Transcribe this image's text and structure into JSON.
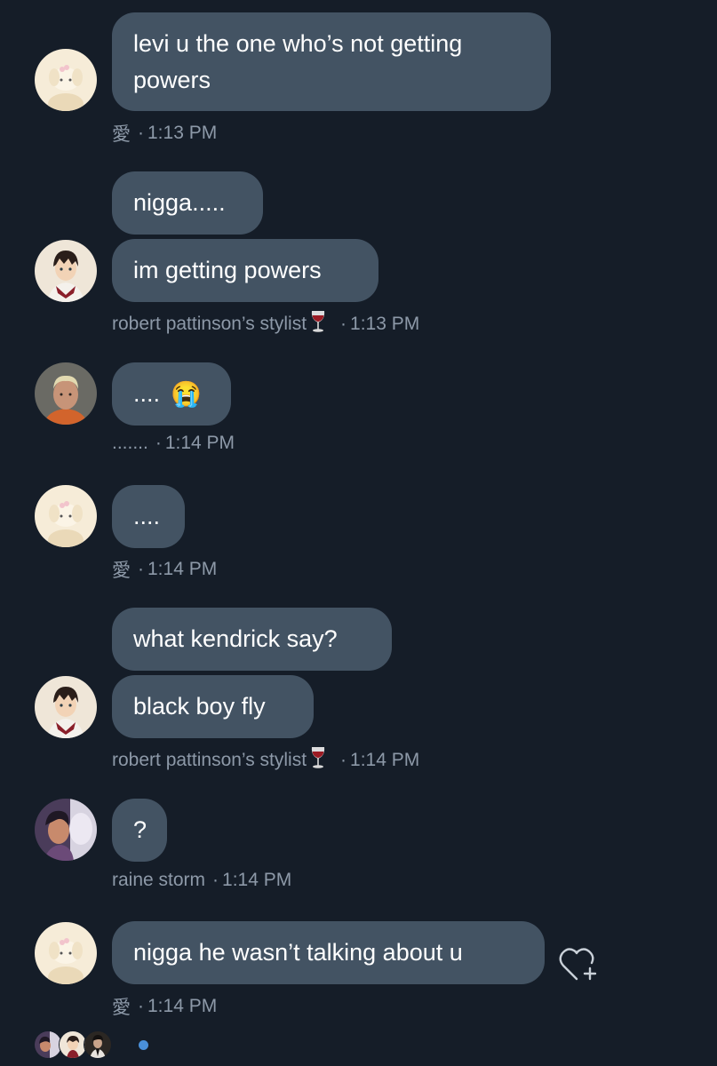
{
  "messages": [
    {
      "text": "levi u the one who’s not getting powers"
    },
    {
      "text": "nigga....."
    },
    {
      "text": "im getting powers"
    },
    {
      "text": "...."
    },
    {
      "text": "...."
    },
    {
      "text": "what kendrick say?"
    },
    {
      "text": "black boy fly"
    },
    {
      "text": "?"
    },
    {
      "text": "nigga he wasn’t talking about u"
    }
  ],
  "emoji": {
    "crying": "😭"
  },
  "meta": [
    {
      "sender": "愛",
      "time": "1:13 PM"
    },
    {
      "sender": "robert pattinson’s stylist",
      "time": "1:13 PM"
    },
    {
      "sender": ".......",
      "time": "1:14 PM"
    },
    {
      "sender": "愛",
      "time": "1:14 PM"
    },
    {
      "sender": "robert pattinson’s stylist",
      "time": "1:14 PM"
    },
    {
      "sender": "raine storm",
      "time": "1:14 PM"
    },
    {
      "sender": "愛",
      "time": "1:14 PM"
    }
  ],
  "separator": "·",
  "icons": {
    "heart_react": "heart-plus-icon",
    "wine": "wine-glass-icon",
    "unread": "unread-dot-icon"
  },
  "colors": {
    "background": "#151d28",
    "bubble": "#435363",
    "meta_text": "#8d99a8",
    "unread_dot": "#4a90d9"
  }
}
